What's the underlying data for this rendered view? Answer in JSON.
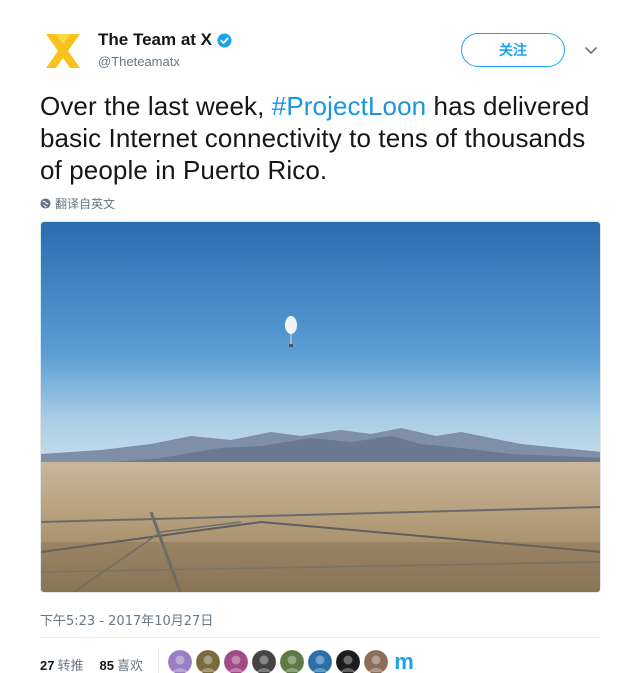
{
  "account": {
    "name": "The Team at X",
    "handle": "@Theteamatx",
    "verified": true,
    "avatar_colors": [
      "#f7c21a",
      "#f9d648"
    ]
  },
  "actions": {
    "follow_label": "关注",
    "menu_icon": "chevron-down-icon"
  },
  "tweet": {
    "text_before": "Over the last week, ",
    "hashtag": "#ProjectLoon",
    "text_after": " has delivered basic Internet connectivity to tens of thousands of people in Puerto Rico.",
    "translate_label": "翻译自英文",
    "timestamp": "下午5:23 - 2017年10月27日"
  },
  "stats": {
    "retweets_count": "27",
    "retweets_label": "转推",
    "likes_count": "85",
    "likes_label": "喜欢"
  },
  "likers": [
    {
      "name": "liker-1",
      "color": "#9b7fc4"
    },
    {
      "name": "liker-2",
      "color": "#7a6a3c"
    },
    {
      "name": "liker-3",
      "color": "#a24a86"
    },
    {
      "name": "liker-4",
      "color": "#444444"
    },
    {
      "name": "liker-5",
      "color": "#5d7a46"
    },
    {
      "name": "liker-6",
      "color": "#2a6fa8"
    },
    {
      "name": "liker-7",
      "color": "#1d1d1d"
    },
    {
      "name": "liker-8",
      "color": "#8a6e5a"
    },
    {
      "name": "liker-9",
      "color": "#1da1f2"
    }
  ],
  "colors": {
    "accent": "#1da1f2",
    "hashtag": "#1b95e0",
    "muted": "#657786"
  }
}
